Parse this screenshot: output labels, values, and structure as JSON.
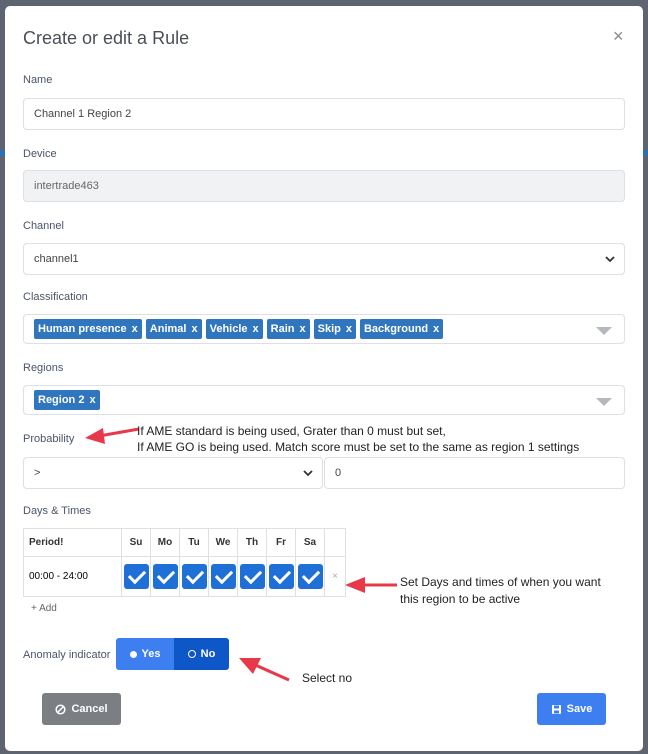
{
  "modal": {
    "title": "Create or edit a Rule",
    "close": "×"
  },
  "name": {
    "label": "Name",
    "value": "Channel 1 Region 2"
  },
  "device": {
    "label": "Device",
    "value": "intertrade463"
  },
  "channel": {
    "label": "Channel",
    "value": "channel1"
  },
  "classification": {
    "label": "Classification",
    "tags": [
      "Human presence",
      "Animal",
      "Vehicle",
      "Rain",
      "Skip",
      "Background"
    ],
    "remove": "x"
  },
  "regions": {
    "label": "Regions",
    "tags": [
      "Region 2"
    ],
    "remove": "x"
  },
  "probability": {
    "label": "Probability",
    "operator": ">",
    "value": "0",
    "note_line1": "If AME standard is being used, Grater than 0 must but set,",
    "note_line2": "If AME GO is being used. Match score must be set to the same as region 1 settings"
  },
  "days_times": {
    "label": "Days & Times",
    "period_header": "Period!",
    "days": [
      "Su",
      "Mo",
      "Tu",
      "We",
      "Th",
      "Fr",
      "Sa"
    ],
    "rows": [
      {
        "period": "00:00 - 24:00",
        "checked": [
          true,
          true,
          true,
          true,
          true,
          true,
          true
        ]
      }
    ],
    "remove": "×",
    "add": "+ Add",
    "note_line1": "Set Days and times of when you want",
    "note_line2": "this region to be active"
  },
  "anomaly": {
    "label": "Anomaly indicator",
    "yes": "Yes",
    "no": "No",
    "selected": "No",
    "note": "Select no"
  },
  "footer": {
    "cancel": "Cancel",
    "save": "Save"
  },
  "colors": {
    "accent": "#1e6fd6",
    "tag": "#2f76bf",
    "cancel": "#7b7e83",
    "save": "#3d7ff0",
    "arrow": "#e8394b"
  }
}
